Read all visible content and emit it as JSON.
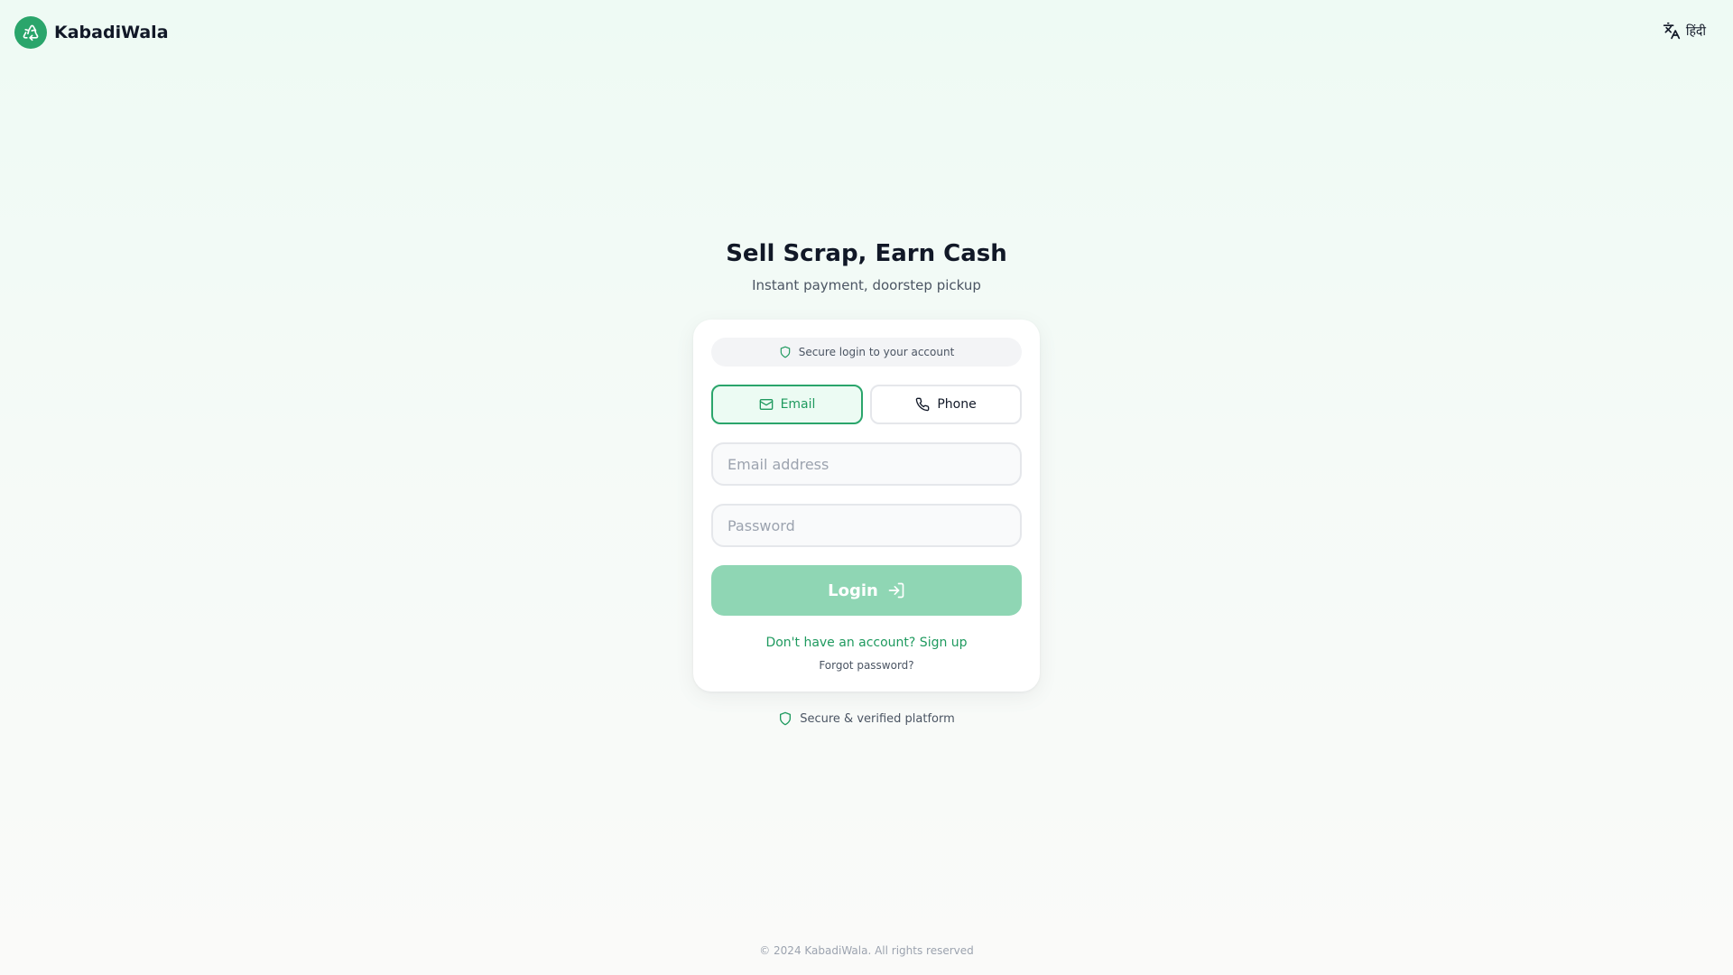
{
  "app": {
    "name": "KabadiWala",
    "logo_icon": "recycle-icon"
  },
  "header": {
    "language_icon": "translate-icon",
    "language_label": "हिंदी"
  },
  "hero": {
    "title": "Sell Scrap, Earn Cash",
    "subtitle": "Instant payment, doorstep pickup"
  },
  "login_card": {
    "secure_note": "Secure login to your account",
    "methods": [
      {
        "label": "Email",
        "icon": "mail-icon",
        "active": true
      },
      {
        "label": "Phone",
        "icon": "phone-icon",
        "active": false
      }
    ],
    "email_placeholder": "Email address",
    "email_value": "",
    "password_placeholder": "Password",
    "password_value": "",
    "login_label": "Login",
    "login_icon": "login-arrow-icon",
    "signup_text": "Don't have an account? Sign up",
    "forgot_text": "Forgot password?"
  },
  "trust_note": "Secure & verified platform",
  "footer": {
    "copyright": "© 2024 KabadiWala. All rights reserved"
  },
  "colors": {
    "brand": "#2aa56b",
    "brand_text": "#1f9a5f",
    "login_button": "#8fd6b4",
    "active_method_bg": "#ecfbf3",
    "page_bg_top": "#eefaf4"
  }
}
